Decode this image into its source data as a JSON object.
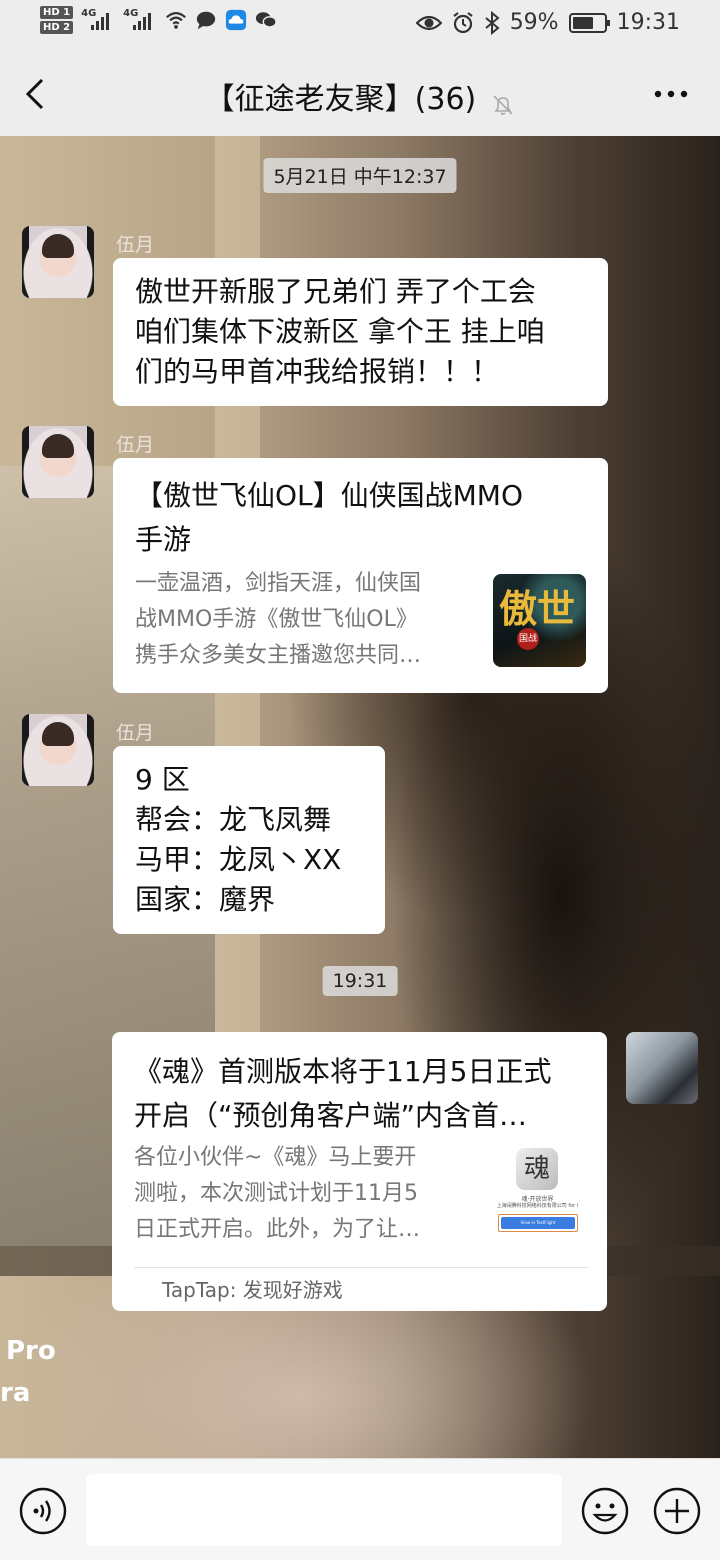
{
  "status_bar": {
    "hd1": "HD 1",
    "hd2": "HD 2",
    "sig1_type": "4G",
    "sig2_type": "4G",
    "battery": "59%",
    "time": "19:31"
  },
  "header": {
    "title": "【征途老友聚】(36)"
  },
  "messages": {
    "ts1": "5月21日 中午12:37",
    "m1": {
      "sender": "伍月",
      "lines": [
        "傲世开新服了兄弟们 弄了个工会",
        "咱们集体下波新区 拿个王  挂上咱",
        "们的马甲首冲我给报销！！！"
      ]
    },
    "m2": {
      "sender": "伍月",
      "title_lines": [
        "【傲世飞仙OL】仙侠国战MMO",
        "手游"
      ],
      "desc_lines": [
        "一壶温酒，剑指天涯，仙侠国",
        "战MMO手游《傲世飞仙OL》",
        "携手众多美女主播邀您共同…"
      ],
      "thumb_text": "傲世",
      "thumb_badge": "国战"
    },
    "m3": {
      "sender": "伍月",
      "lines": [
        "9 区",
        "帮会：龙飞凤舞",
        "马甲：龙凤丶XX",
        "国家：魔界"
      ]
    },
    "ts2": "19:31",
    "m4": {
      "title_lines": [
        "《魂》首测版本将于11月5日正式",
        "开启（“预创角客户端”内含首…"
      ],
      "desc_lines": [
        "各位小伙伴~《魂》马上要开",
        "测啦，本次测试计划于11月5",
        "日正式开启。此外，为了让…"
      ],
      "thumb_logo": "魂",
      "thumb_sub1": "魂·开放世界",
      "thumb_sub2": "上海闹腾科技网络科技有限公司 for i",
      "thumb_btn": "View in TestFlight",
      "source": "TapTap: 发现好游戏"
    }
  },
  "watermark": {
    "line1": "Pro",
    "line2": "ra"
  },
  "colors": {
    "bubble": "#ffffff",
    "background": "#ededed",
    "desc": "#777777"
  }
}
